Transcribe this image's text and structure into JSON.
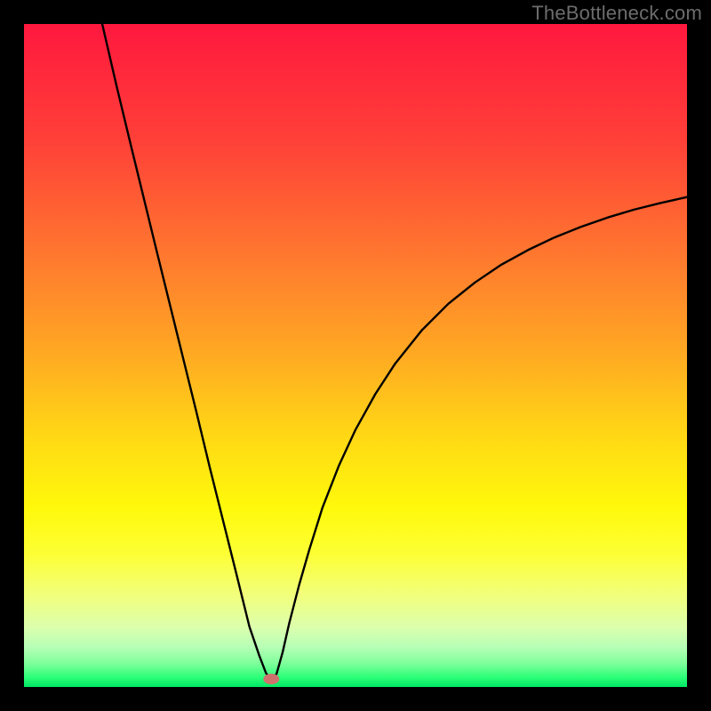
{
  "watermark": "TheBottleneck.com",
  "chart_data": {
    "type": "line",
    "title": "",
    "xlabel": "",
    "ylabel": "",
    "xlim": [
      0,
      100
    ],
    "ylim": [
      0,
      100
    ],
    "grid": false,
    "legend": false,
    "notch_x": 37.3,
    "marker": {
      "x": 37.3,
      "y": 1.2,
      "color": "#cf726e"
    },
    "series": [
      {
        "name": "bottleneck-curve",
        "color": "#000000",
        "x": [
          11.8,
          14,
          16,
          18,
          20,
          22,
          24,
          26,
          28,
          30,
          32,
          34,
          35.5,
          36.5,
          37.3,
          38.1,
          39,
          40,
          41.5,
          43,
          45,
          47.5,
          50,
          53,
          56,
          60,
          64,
          68,
          72,
          76,
          80,
          84,
          88,
          92,
          96,
          100
        ],
        "y": [
          100,
          90.5,
          82.2,
          74,
          65.8,
          57.7,
          49.6,
          41.5,
          33.2,
          25.2,
          17.2,
          9.1,
          4.7,
          2.1,
          1.0,
          2.0,
          5.2,
          9.6,
          15.4,
          20.6,
          27.0,
          33.4,
          38.8,
          44.2,
          48.8,
          53.8,
          57.8,
          61.0,
          63.7,
          65.9,
          67.8,
          69.4,
          70.8,
          72.0,
          73.0,
          73.9
        ]
      }
    ],
    "background_gradient_stops": [
      {
        "offset": 0,
        "color": "#ff183e"
      },
      {
        "offset": 0.18,
        "color": "#ff4138"
      },
      {
        "offset": 0.35,
        "color": "#ff782f"
      },
      {
        "offset": 0.5,
        "color": "#ffaa22"
      },
      {
        "offset": 0.63,
        "color": "#ffdb14"
      },
      {
        "offset": 0.73,
        "color": "#fff90b"
      },
      {
        "offset": 0.8,
        "color": "#fdff35"
      },
      {
        "offset": 0.86,
        "color": "#f2ff7a"
      },
      {
        "offset": 0.91,
        "color": "#dcffad"
      },
      {
        "offset": 0.94,
        "color": "#b6ffb6"
      },
      {
        "offset": 0.965,
        "color": "#7dff9a"
      },
      {
        "offset": 0.985,
        "color": "#2dff78"
      },
      {
        "offset": 1.0,
        "color": "#00e765"
      }
    ]
  }
}
